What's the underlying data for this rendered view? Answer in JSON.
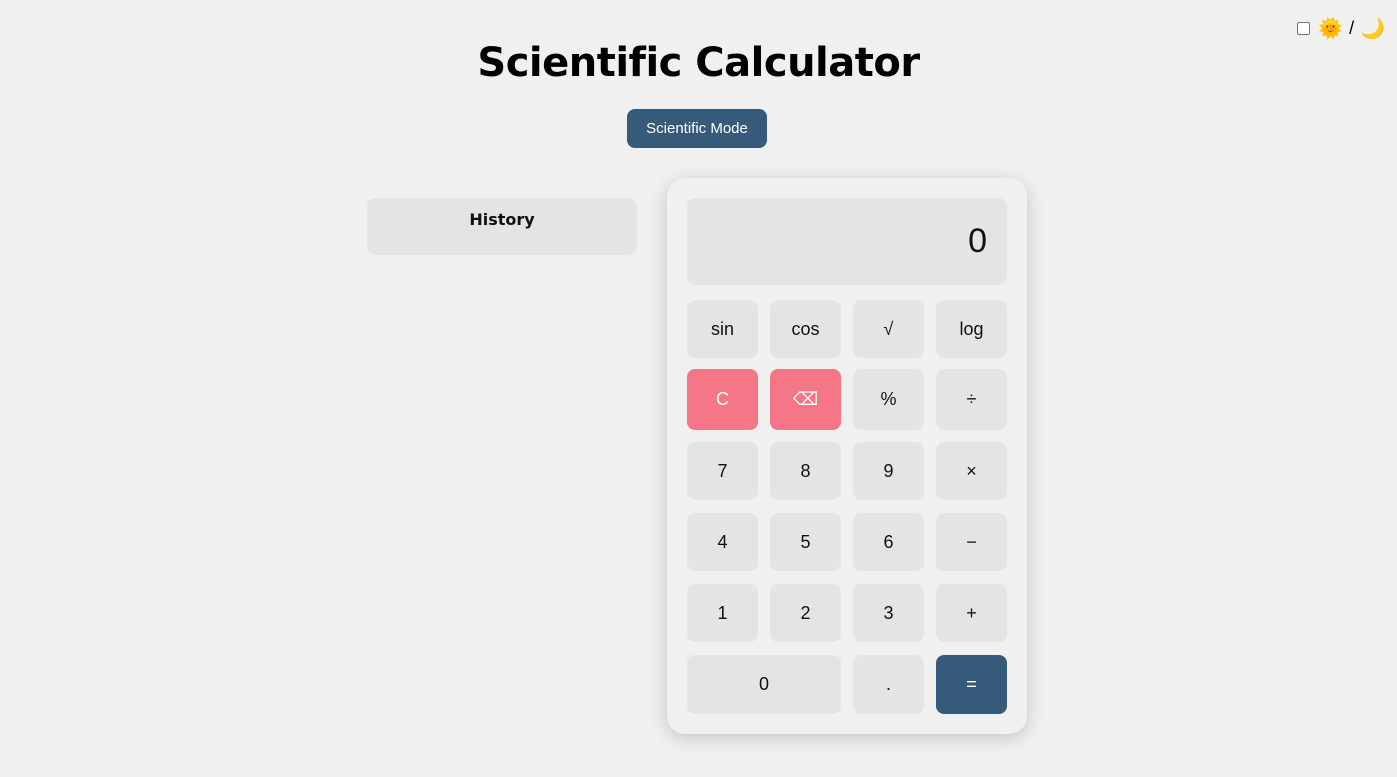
{
  "theme_toggle": {
    "sun": "🌞",
    "separator": "/",
    "moon": "🌙"
  },
  "title": "Scientific Calculator",
  "mode_button": "Scientific Mode",
  "history": {
    "title": "History"
  },
  "display": {
    "value": "0"
  },
  "keys": {
    "sin": "sin",
    "cos": "cos",
    "sqrt": "√",
    "log": "log",
    "clear": "C",
    "backspace": "⌫",
    "percent": "%",
    "divide": "÷",
    "seven": "7",
    "eight": "8",
    "nine": "9",
    "multiply": "×",
    "four": "4",
    "five": "5",
    "six": "6",
    "minus": "−",
    "one": "1",
    "two": "2",
    "three": "3",
    "plus": "+",
    "zero": "0",
    "dot": ".",
    "equals": "="
  },
  "colors": {
    "primary": "#365a7a",
    "danger": "#f57687",
    "key": "#e4e4e4",
    "background": "#f0f0f0"
  }
}
